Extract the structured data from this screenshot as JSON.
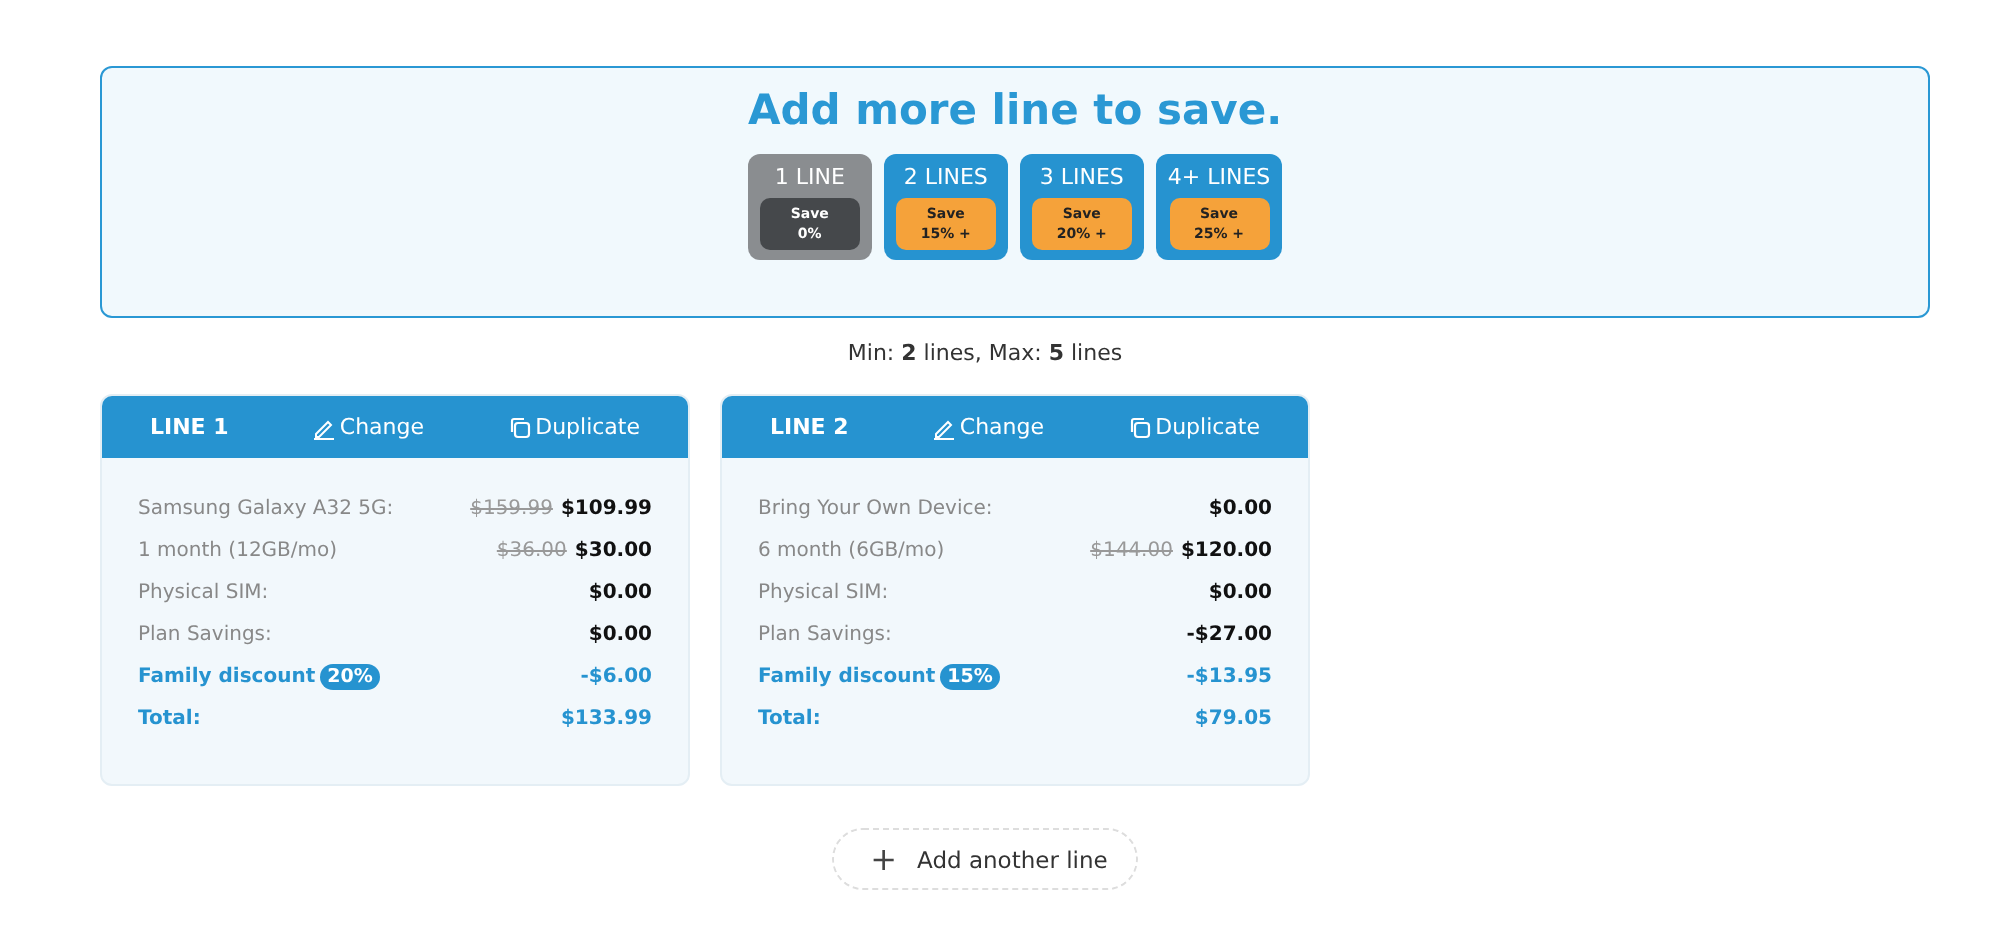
{
  "banner": {
    "title": "Add more line to save.",
    "tiers": [
      {
        "label": "1 LINE",
        "save": "Save",
        "amount": "0%",
        "selected": true
      },
      {
        "label": "2 LINES",
        "save": "Save",
        "amount": "15% +",
        "selected": false
      },
      {
        "label": "3 LINES",
        "save": "Save",
        "amount": "20% +",
        "selected": false
      },
      {
        "label": "4+ LINES",
        "save": "Save",
        "amount": "25% +",
        "selected": false
      }
    ]
  },
  "limits": "Min: **2** lines, Max: **5** lines",
  "lines": [
    {
      "title": "LINE 1",
      "change": "Change",
      "duplicate": "Duplicate",
      "rows": [
        {
          "kind": "item",
          "label": "Samsung Galaxy A32 5G:",
          "old_price": "$159.99",
          "price": "$109.99"
        },
        {
          "kind": "item",
          "label": "1 month (12GB/mo)",
          "old_price": "$36.00",
          "price": "$30.00"
        },
        {
          "kind": "item",
          "label": "Physical SIM:",
          "price": "$0.00"
        },
        {
          "kind": "item",
          "label": "Plan Savings:",
          "price": "$0.00"
        },
        {
          "kind": "discount",
          "label": "Family discount",
          "badge": "20%",
          "price": "-$6.00"
        },
        {
          "kind": "total",
          "label": "Total:",
          "price": "$133.99"
        }
      ]
    },
    {
      "title": "LINE 2",
      "change": "Change",
      "duplicate": "Duplicate",
      "rows": [
        {
          "kind": "item",
          "label": "Bring Your Own Device:",
          "price": "$0.00"
        },
        {
          "kind": "item",
          "label": "6 month (6GB/mo)",
          "old_price": "$144.00",
          "price": "$120.00"
        },
        {
          "kind": "item",
          "label": "Physical SIM:",
          "price": "$0.00"
        },
        {
          "kind": "item",
          "label": "Plan Savings:",
          "price": "-$27.00"
        },
        {
          "kind": "discount",
          "label": "Family discount",
          "badge": "15%",
          "price": "-$13.95"
        },
        {
          "kind": "total",
          "label": "Total:",
          "price": "$79.05"
        }
      ]
    }
  ],
  "add_button": {
    "icon": "+",
    "label": "Add another line"
  }
}
